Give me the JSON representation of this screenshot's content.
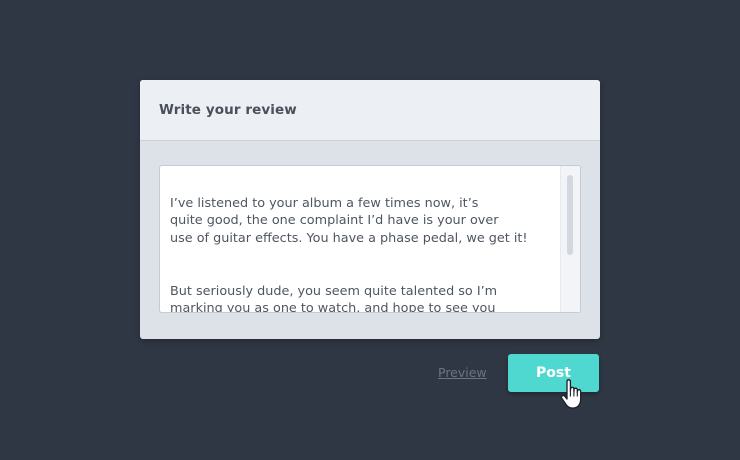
{
  "card": {
    "title": "Write your review"
  },
  "review": {
    "paragraph1": "I’ve listened to your album a few times now, it’s\nquite good, the one complaint I’d have is your over\nuse of guitar effects. You have a phase pedal, we get it!",
    "paragraph2": "But seriously dude, you seem quite talented so I’m\nmarking you as one to watch, and hope to see you\nin Toronto soon."
  },
  "actions": {
    "preview_label": "Preview",
    "post_label": "Post"
  },
  "colors": {
    "background": "#2f3744",
    "accent": "#4ed8d0"
  },
  "icons": {
    "cursor": "hand-pointer-icon"
  }
}
